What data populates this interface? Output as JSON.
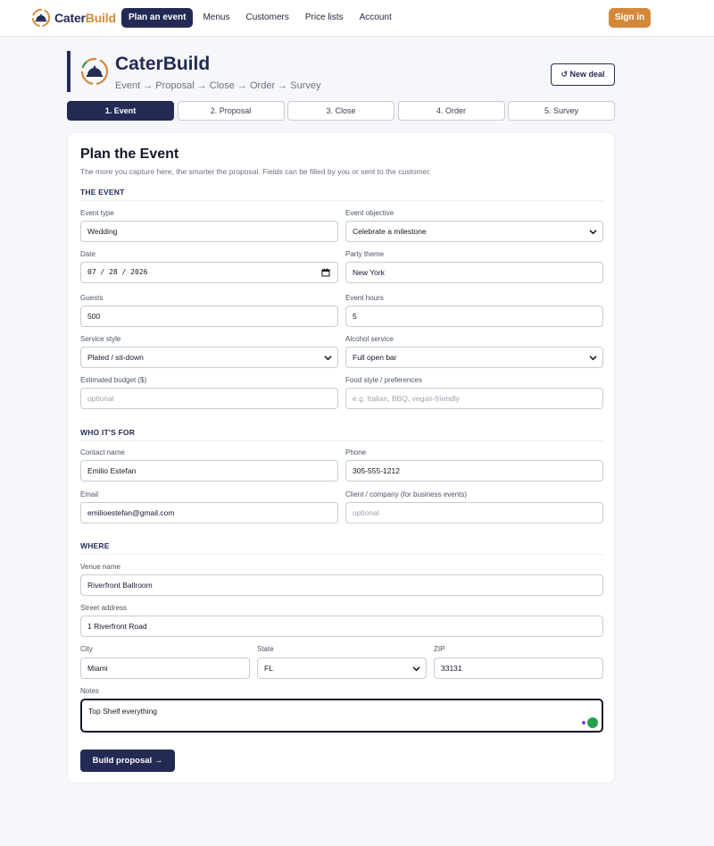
{
  "brand": {
    "name_part1": "Cater",
    "name_part2": "Build"
  },
  "nav": {
    "items": [
      {
        "label": "Plan an event",
        "active": true
      },
      {
        "label": "Menus"
      },
      {
        "label": "Customers"
      },
      {
        "label": "Price lists"
      },
      {
        "label": "Account"
      }
    ],
    "signin_label": "Sign in"
  },
  "header": {
    "title": "CaterBuild",
    "subtitle": "Event → Proposal → Close → Order → Survey",
    "new_deal_label": "↺ New deal"
  },
  "steps": [
    {
      "label": "1. Event",
      "active": true
    },
    {
      "label": "2. Proposal"
    },
    {
      "label": "3. Close"
    },
    {
      "label": "4. Order"
    },
    {
      "label": "5. Survey"
    }
  ],
  "form": {
    "title": "Plan the Event",
    "description": "The more you capture here, the smarter the proposal. Fields can be filled by you or sent to the customer.",
    "sections": {
      "event": "THE EVENT",
      "who": "WHO IT'S FOR",
      "where": "WHERE"
    },
    "event_type": {
      "label": "Event type",
      "value": "Wedding"
    },
    "event_objective": {
      "label": "Event objective",
      "value": "Celebrate a milestone"
    },
    "date": {
      "label": "Date",
      "value": "07 / 28 / 2026"
    },
    "party_theme": {
      "label": "Party theme",
      "value": "New York"
    },
    "guests": {
      "label": "Guests",
      "value": "500"
    },
    "event_hours": {
      "label": "Event hours",
      "value": "5"
    },
    "service_style": {
      "label": "Service style",
      "value": "Plated / sit-down"
    },
    "alcohol_service": {
      "label": "Alcohol service",
      "value": "Full open bar"
    },
    "budget": {
      "label": "Estimated budget ($)",
      "placeholder": "optional"
    },
    "food_style": {
      "label": "Food style / preferences",
      "placeholder": "e.g. Italian, BBQ, vegan-friendly"
    },
    "contact_name": {
      "label": "Contact name",
      "value": "Emilio Estefan"
    },
    "phone": {
      "label": "Phone",
      "value": "305-555-1212"
    },
    "email": {
      "label": "Email",
      "value": "emilioestefan@gmail.com"
    },
    "company": {
      "label": "Client / company (for business events)",
      "placeholder": "optional"
    },
    "venue": {
      "label": "Venue name",
      "value": "Riverfront Ballroom"
    },
    "street": {
      "label": "Street address",
      "value": "1 Riverfront Road"
    },
    "city": {
      "label": "City",
      "value": "Miami"
    },
    "state": {
      "label": "State",
      "value": "FL"
    },
    "zip": {
      "label": "ZIP",
      "value": "33131"
    },
    "notes": {
      "label": "Notes",
      "value": "Top Shelf everything"
    },
    "build_label": "Build proposal →"
  },
  "colors": {
    "navy": "#232b55",
    "orange": "#d4893a"
  }
}
